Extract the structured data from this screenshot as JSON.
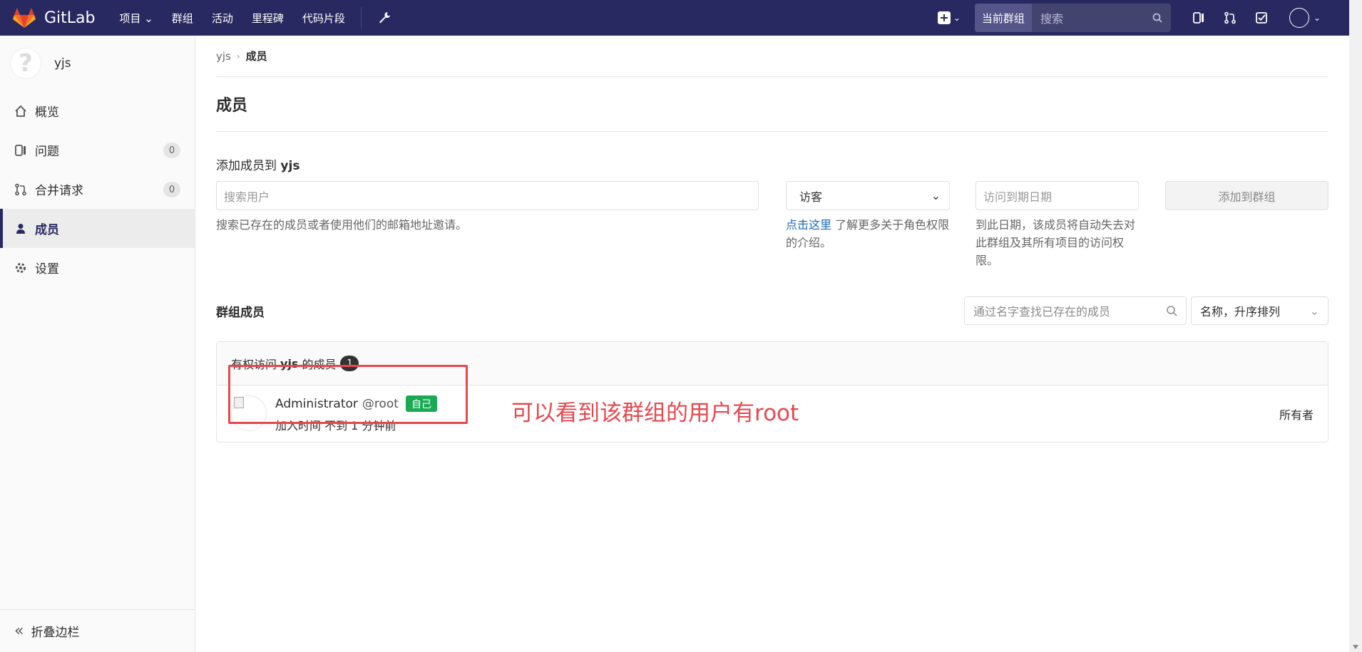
{
  "topnav": {
    "brand": "GitLab",
    "links": [
      "项目",
      "群组",
      "活动",
      "里程碑",
      "代码片段"
    ],
    "scope": "当前群组",
    "search_placeholder": "搜索"
  },
  "sidebar": {
    "group_name": "yjs",
    "items": [
      {
        "label": "概览",
        "icon": "home-icon"
      },
      {
        "label": "问题",
        "icon": "issues-icon",
        "count": "0"
      },
      {
        "label": "合并请求",
        "icon": "merge-request-icon",
        "count": "0"
      },
      {
        "label": "成员",
        "icon": "users-icon",
        "active": true
      },
      {
        "label": "设置",
        "icon": "settings-icon"
      }
    ],
    "collapse": "折叠边栏"
  },
  "breadcrumb": {
    "group": "yjs",
    "current": "成员"
  },
  "page_title": "成员",
  "add_form": {
    "label_prefix": "添加成员到",
    "label_group": "yjs",
    "user_placeholder": "搜索用户",
    "user_help": "搜索已存在的成员或者使用他们的邮箱地址邀请。",
    "role_value": "访客",
    "role_help_link": "点击这里",
    "role_help_text": "了解更多关于角色权限的介绍。",
    "date_placeholder": "访问到期日期",
    "date_help": "到此日期，该成员将自动失去对此群组及其所有项目的访问权限。",
    "submit": "添加到群组"
  },
  "members": {
    "heading": "群组成员",
    "search_placeholder": "通过名字查找已存在的成员",
    "sort": "名称，升序排列",
    "panel_prefix": "有权访问",
    "panel_group": "yjs",
    "panel_suffix": "的成员",
    "count": "1",
    "rows": [
      {
        "name": "Administrator",
        "username": "@root",
        "self_badge": "自己",
        "joined": "加入时间 不到 1 分钟前",
        "role": "所有者"
      }
    ]
  },
  "annotation": "可以看到该群组的用户有root",
  "colors": {
    "nav": "#292961",
    "accent": "#1b69b6",
    "annotation": "#e5484d",
    "self_badge": "#1aaa55"
  }
}
